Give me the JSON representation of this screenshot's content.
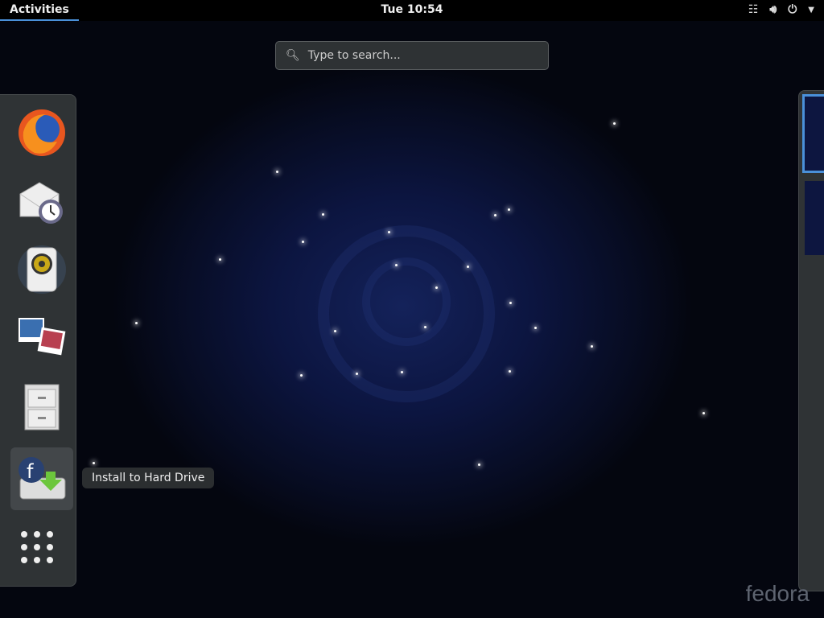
{
  "topbar": {
    "activities": "Activities",
    "clock": "Tue 10:54"
  },
  "search": {
    "placeholder": "Type to search..."
  },
  "dash": {
    "apps": [
      {
        "name": "Firefox",
        "icon": "firefox-icon"
      },
      {
        "name": "Evolution",
        "icon": "mail-clock-icon"
      },
      {
        "name": "Rhythmbox",
        "icon": "speaker-icon"
      },
      {
        "name": "Shotwell",
        "icon": "photos-icon"
      },
      {
        "name": "Files",
        "icon": "file-cabinet-icon"
      },
      {
        "name": "Install to Hard Drive",
        "icon": "fedora-install-icon"
      }
    ],
    "tooltip": "Install to Hard Drive"
  },
  "watermark": "fedora"
}
